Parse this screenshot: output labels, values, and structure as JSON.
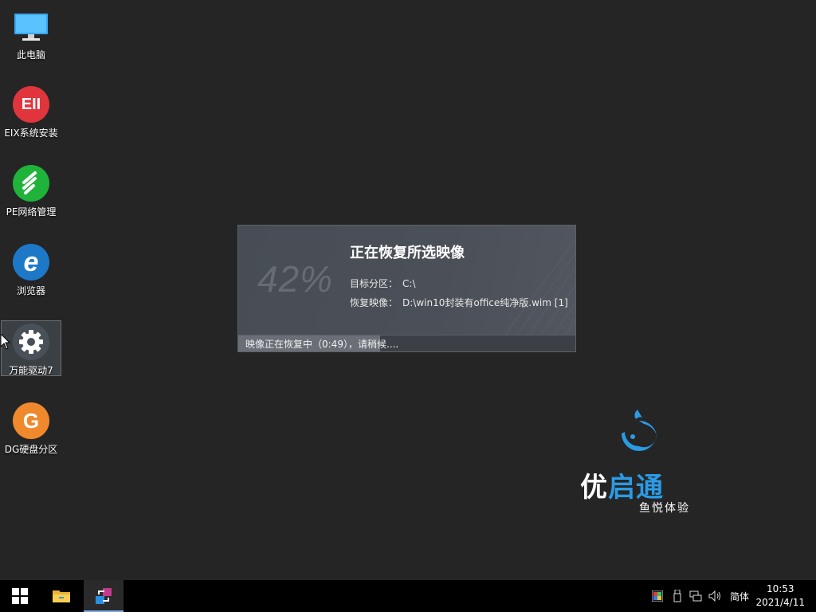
{
  "desktop": {
    "icons": [
      {
        "label": "此电脑",
        "icon": "computer-icon"
      },
      {
        "label": "EIX系统安装",
        "icon": "eix-icon",
        "glyph": "EII",
        "color": "#e0353d"
      },
      {
        "label": "PE网络管理",
        "icon": "network-manager-icon",
        "color": "#1fb33b"
      },
      {
        "label": "浏览器",
        "icon": "browser-icon",
        "glyph": "e",
        "color": "#1e78c8"
      },
      {
        "label": "万能驱动7",
        "icon": "gear-icon",
        "color": "#4a5058"
      },
      {
        "label": "DG硬盘分区",
        "icon": "diskgenius-icon",
        "glyph": "G",
        "color": "#f0892c"
      }
    ]
  },
  "dialog": {
    "percent_text": "42%",
    "progress": 0.42,
    "title": "正在恢复所选映像",
    "target_label": "目标分区：",
    "target_value": "C:\\",
    "image_label": "恢复映像：",
    "image_value": "D:\\win10封装有office纯净版.wim [1]",
    "status_text": "映像正在恢复中（0:49），请稍候...."
  },
  "brand": {
    "name_part1": "优",
    "name_part2": "启通",
    "slogan": "鱼悦体验",
    "color": "#2b9be6"
  },
  "taskbar": {
    "start_icon": "windows-start-icon",
    "apps": [
      "file-explorer-icon",
      "restore-tool-icon"
    ],
    "tray_icons": [
      "color-icon",
      "usb-icon",
      "network-icon",
      "volume-icon"
    ],
    "ime": "简体",
    "time": "10:53",
    "date": "2021/4/11"
  }
}
